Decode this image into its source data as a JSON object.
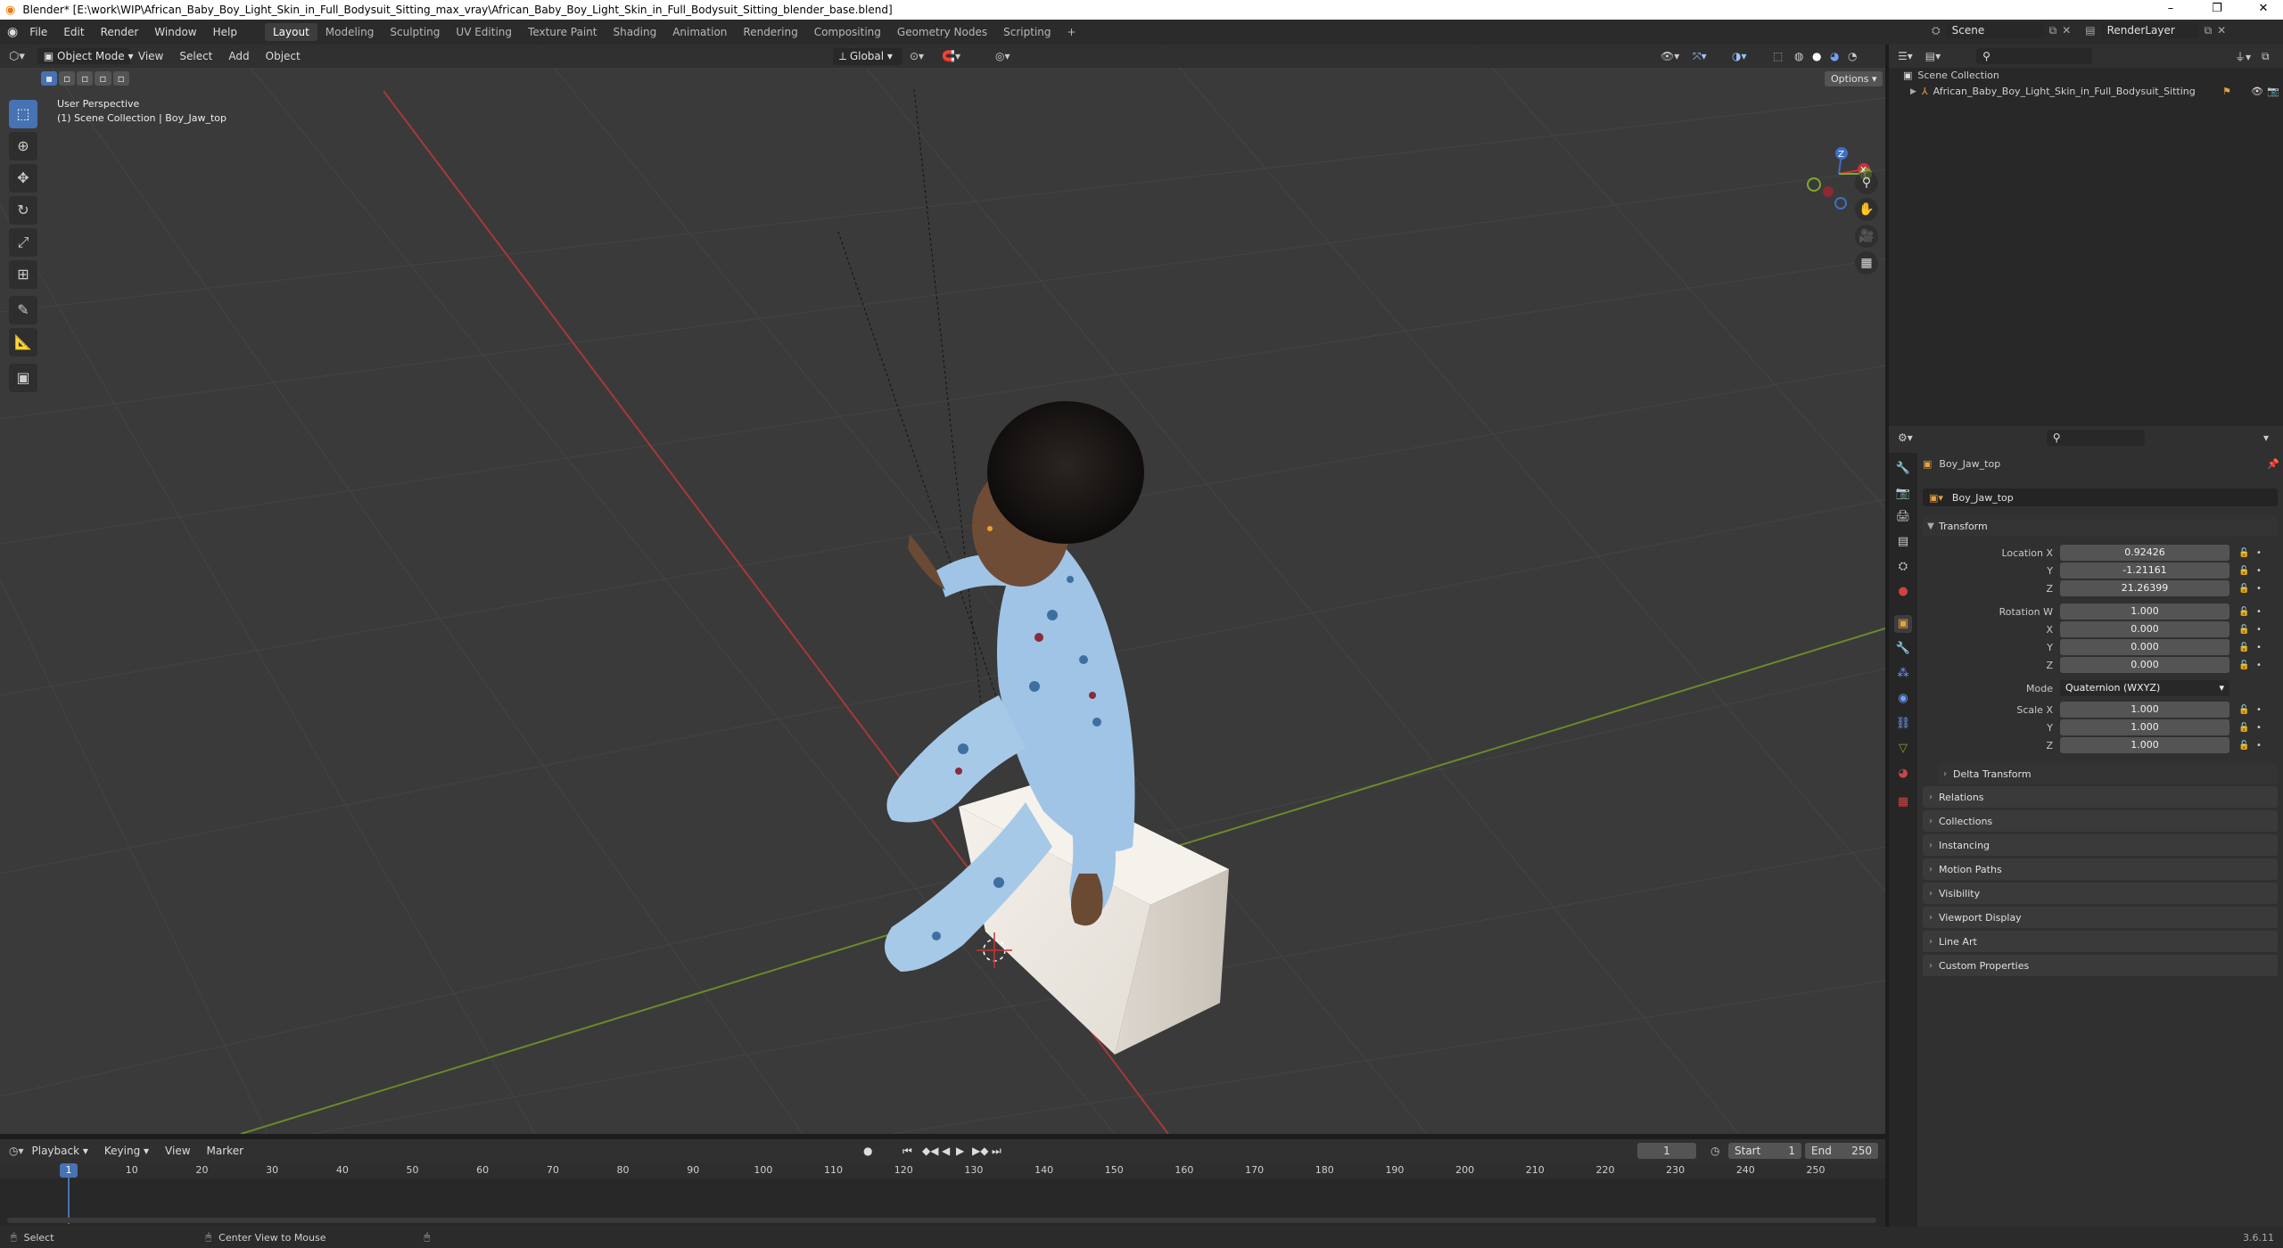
{
  "window": {
    "title": "Blender* [E:\\work\\WIP\\African_Baby_Boy_Light_Skin_in_Full_Bodysuit_Sitting_max_vray\\African_Baby_Boy_Light_Skin_in_Full_Bodysuit_Sitting_blender_base.blend]",
    "minimize": "–",
    "maximize": "❐",
    "close": "✕"
  },
  "menu": {
    "items": [
      "File",
      "Edit",
      "Render",
      "Window",
      "Help"
    ],
    "workspaces": [
      "Layout",
      "Modeling",
      "Sculpting",
      "UV Editing",
      "Texture Paint",
      "Shading",
      "Animation",
      "Rendering",
      "Compositing",
      "Geometry Nodes",
      "Scripting"
    ],
    "active_workspace": "Layout",
    "add_workspace": "+",
    "scene_label": "Scene",
    "view_layer_label": "RenderLayer"
  },
  "viewport": {
    "mode": "Object Mode",
    "header_menus": [
      "View",
      "Select",
      "Add",
      "Object"
    ],
    "orientation": "Global",
    "options": "Options",
    "overlay_title": "User Perspective",
    "overlay_subtitle": "(1) Scene Collection | Boy_Jaw_top",
    "gizmo": {
      "x": "X",
      "y": "Y",
      "z": "Z"
    },
    "colors": {
      "bg": "#3a3a3a",
      "x_axis": "#b53a3a",
      "y_axis": "#6a8a2a",
      "grid": "#434343"
    }
  },
  "tools": [
    "select-box-icon",
    "cursor-icon",
    "move-icon",
    "rotate-icon",
    "scale-icon",
    "transform-icon",
    "annotate-icon",
    "measure-icon",
    "add-cube-icon"
  ],
  "outliner": {
    "root": "Scene Collection",
    "items": [
      {
        "name": "African_Baby_Boy_Light_Skin_in_Full_Bodysuit_Sitting"
      }
    ]
  },
  "properties": {
    "object_name": "Boy_Jaw_top",
    "data_name": "Boy_Jaw_top",
    "transform_title": "Transform",
    "location": {
      "label": "Location X",
      "x": "0.92426",
      "y": "-1.21161",
      "z": "21.26399"
    },
    "rotation": {
      "label": "Rotation W",
      "w": "1.000",
      "x": "0.000",
      "y": "0.000",
      "z": "0.000"
    },
    "mode": {
      "label": "Mode",
      "value": "Quaternion (WXYZ)"
    },
    "scale": {
      "label": "Scale X",
      "x": "1.000",
      "y": "1.000",
      "z": "1.000"
    },
    "axis_labels": {
      "x": "X",
      "y": "Y",
      "z": "Z"
    },
    "delta": "Delta Transform",
    "panels": [
      "Relations",
      "Collections",
      "Instancing",
      "Motion Paths",
      "Visibility",
      "Viewport Display",
      "Line Art",
      "Custom Properties"
    ]
  },
  "timeline": {
    "menus": [
      "Playback",
      "Keying",
      "View",
      "Marker"
    ],
    "current_frame": "1",
    "start_label": "Start",
    "start": "1",
    "end_label": "End",
    "end": "250",
    "ruler": [
      "10",
      "20",
      "30",
      "40",
      "50",
      "60",
      "70",
      "80",
      "90",
      "100",
      "110",
      "120",
      "130",
      "140",
      "150",
      "160",
      "170",
      "180",
      "190",
      "200",
      "210",
      "220",
      "230",
      "240",
      "250"
    ]
  },
  "status": {
    "select": "Select",
    "center": "Center View to Mouse",
    "version": "3.6.11"
  }
}
